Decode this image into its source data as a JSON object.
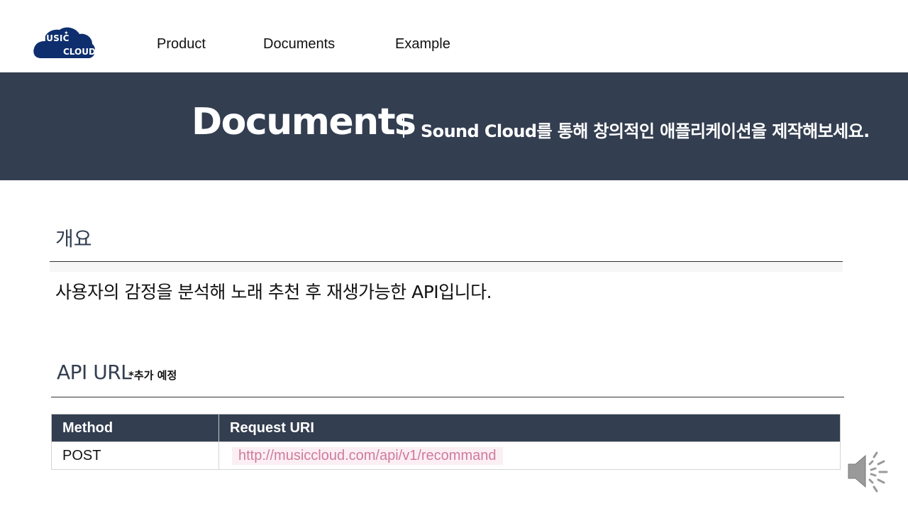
{
  "nav": {
    "logo": {
      "line1": "MUSIC",
      "line2": "CLOUD",
      "color": "#0e2e6e"
    },
    "links": [
      "Product",
      "Documents",
      "Example"
    ]
  },
  "banner": {
    "title": "Documents",
    "subtitle": "Sound Cloud를 통해 창의적인 애플리케이션을 제작해보세요.",
    "background": "#333e50"
  },
  "overview": {
    "heading": "개요",
    "description": "사용자의 감정을 분석해 노래 추천 후 재생가능한 API입니다."
  },
  "api_url": {
    "heading": "API URL",
    "note": "*추가 예정",
    "table": {
      "headers": [
        "Method",
        "Request URI"
      ],
      "rows": [
        {
          "method": "POST",
          "uri": "http://musiccloud.com/api/v1/recommand"
        }
      ]
    }
  },
  "icons": {
    "speaker": "speaker-icon"
  },
  "colors": {
    "accent": "#333e50",
    "uri_text": "#d07a9c",
    "uri_bg": "#fbeff3"
  }
}
